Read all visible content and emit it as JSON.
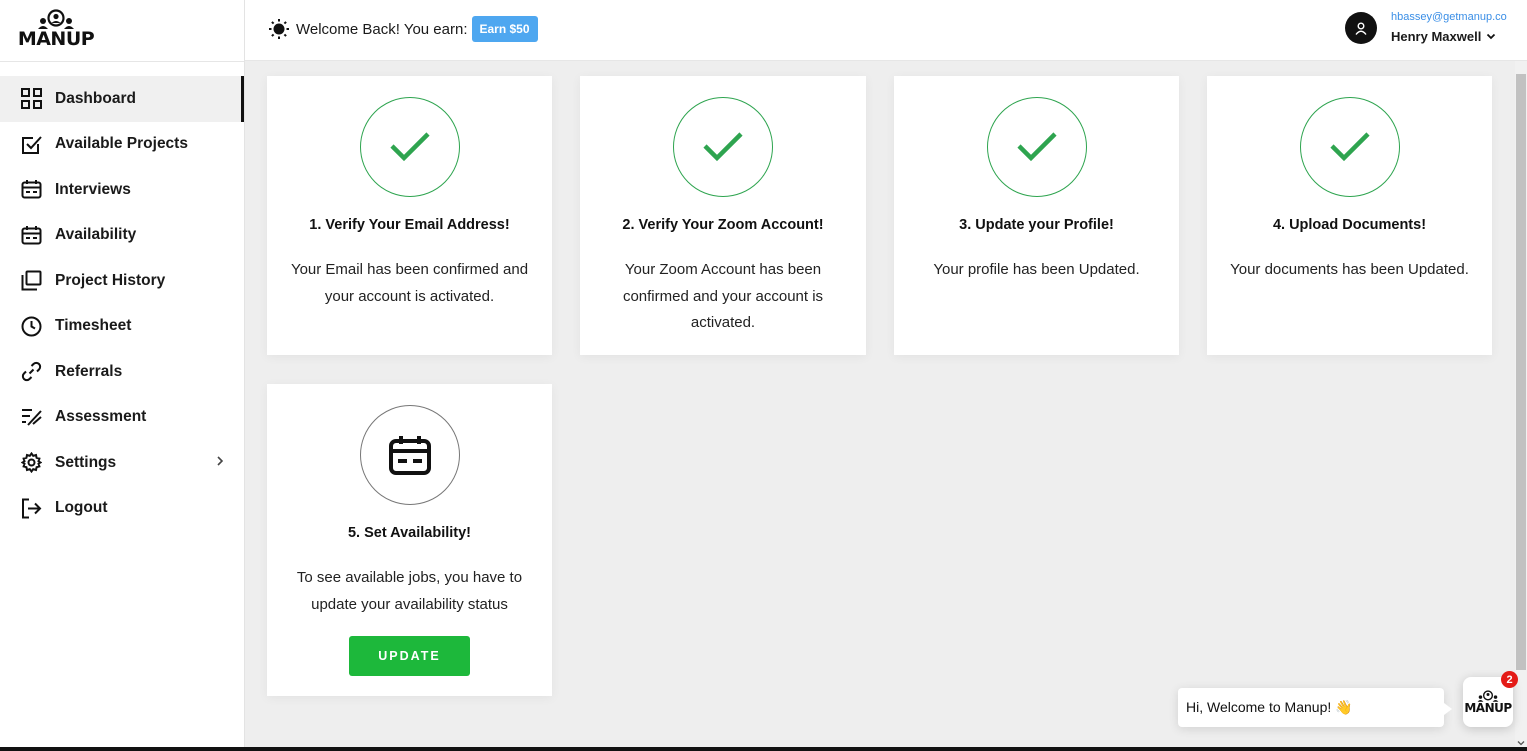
{
  "brand": {
    "name": "MANUP"
  },
  "sidebar": {
    "items": [
      {
        "label": "Dashboard",
        "icon": "dashboard-grid-icon",
        "active": true
      },
      {
        "label": "Available Projects",
        "icon": "checkbox-icon"
      },
      {
        "label": "Interviews",
        "icon": "calendar-icon"
      },
      {
        "label": "Availability",
        "icon": "calendar-icon"
      },
      {
        "label": "Project History",
        "icon": "folders-icon"
      },
      {
        "label": "Timesheet",
        "icon": "clock-icon"
      },
      {
        "label": "Referrals",
        "icon": "link-icon"
      },
      {
        "label": "Assessment",
        "icon": "checklist-icon"
      },
      {
        "label": "Settings",
        "icon": "gear-icon"
      },
      {
        "label": "Logout",
        "icon": "logout-icon"
      }
    ]
  },
  "header": {
    "welcome_text": "Welcome Back! You earn:",
    "earn_badge": "Earn $50",
    "user_email": "hbassey@getmanup.co",
    "user_name": "Henry Maxwell"
  },
  "cards": [
    {
      "title": "1. Verify Your Email Address!",
      "description": "Your Email has been confirmed and your account is activated.",
      "status": "complete",
      "icon": "checkmark-icon"
    },
    {
      "title": "2. Verify Your Zoom Account!",
      "description": "Your Zoom Account has been confirmed and your account is activated.",
      "status": "complete",
      "icon": "checkmark-icon"
    },
    {
      "title": "3. Update your Profile!",
      "description": "Your profile has been Updated.",
      "status": "complete",
      "icon": "checkmark-icon"
    },
    {
      "title": "4. Upload Documents!",
      "description": "Your documents has been Updated.",
      "status": "complete",
      "icon": "checkmark-icon"
    },
    {
      "title": "5. Set Availability!",
      "description": "To see available jobs, you have to update your availability status",
      "status": "pending",
      "icon": "calendar-icon",
      "button_label": "UPDATE"
    }
  ],
  "chat": {
    "message": "Hi, Welcome to Manup! 👋",
    "launcher_label": "MANUP",
    "unread_count": "2"
  },
  "colors": {
    "success": "#2ea44f",
    "update_button": "#1db83b",
    "earn_badge": "#4ea7f0",
    "email_link": "#3a8ee6",
    "notification": "#e41b17"
  }
}
